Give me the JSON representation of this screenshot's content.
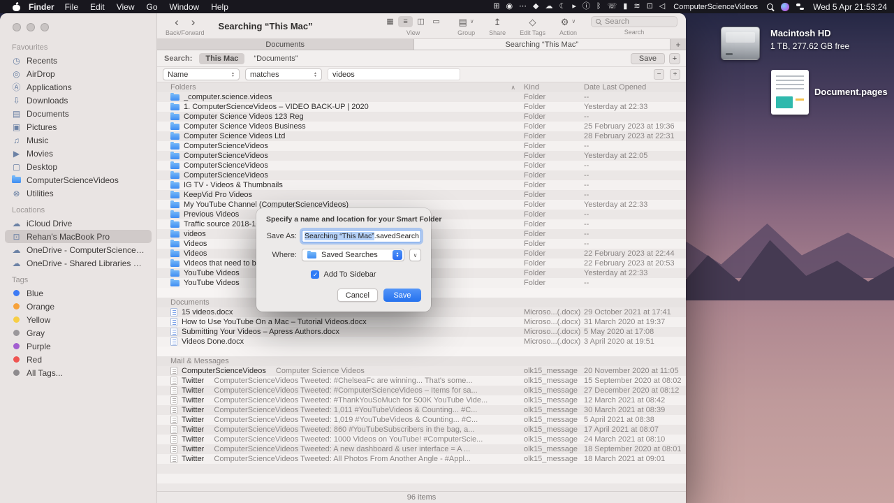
{
  "menubar": {
    "apple_icon": "apple-logo",
    "app_name": "Finder",
    "menus": [
      "File",
      "Edit",
      "View",
      "Go",
      "Window",
      "Help"
    ],
    "status_icons": [
      {
        "name": "window-manager-icon",
        "glyph": "⊞"
      },
      {
        "name": "camera-icon",
        "glyph": "◉"
      },
      {
        "name": "more-options-icon",
        "glyph": "⋯"
      },
      {
        "name": "app-status-icon",
        "glyph": "◆"
      },
      {
        "name": "cloud-sync-icon",
        "glyph": "☁"
      },
      {
        "name": "do-not-disturb-icon",
        "glyph": "☾"
      },
      {
        "name": "screen-record-icon",
        "glyph": "▸"
      },
      {
        "name": "info-icon",
        "glyph": "ⓘ"
      },
      {
        "name": "bluetooth-icon",
        "glyph": "ᛒ"
      },
      {
        "name": "phone-icon",
        "glyph": "☏"
      },
      {
        "name": "battery-icon",
        "glyph": "▮"
      },
      {
        "name": "wifi-icon",
        "glyph": "≋"
      },
      {
        "name": "display-icon",
        "glyph": "⊡"
      },
      {
        "name": "volume-icon",
        "glyph": "◁"
      }
    ],
    "status_text": "ComputerScienceVideos",
    "system_icons": [
      {
        "name": "spotlight-icon",
        "css": "spotlight"
      },
      {
        "name": "siri-icon",
        "css": "siri"
      },
      {
        "name": "control-center-icon",
        "css": "control-center"
      }
    ],
    "clock": "Wed 5 Apr 21:53:24"
  },
  "desktop": {
    "volume": {
      "name": "Macintosh HD",
      "detail": "1 TB, 277.62 GB free"
    },
    "file": {
      "name": "Document.pages"
    }
  },
  "window": {
    "title": "Searching “This Mac”",
    "toolbar": {
      "back_icon": "‹",
      "forward_icon": "›",
      "back_forward_label": "Back/Forward",
      "view_label": "View",
      "view_segments": [
        {
          "name": "icon-view-icon",
          "glyph": "▦"
        },
        {
          "name": "list-view-icon",
          "glyph": "≡",
          "selected": true
        },
        {
          "name": "column-view-icon",
          "glyph": "◫"
        },
        {
          "name": "gallery-view-icon",
          "glyph": "▭"
        }
      ],
      "group_icon": "▤",
      "group_label": "Group",
      "share_icon": "↥",
      "share_label": "Share",
      "tags_icon": "◇",
      "edit_tags_label": "Edit Tags",
      "action_icon": "⚙",
      "action_label": "Action",
      "caret": "∨",
      "search_placeholder": "Search",
      "search_label": "Search"
    },
    "tabs": [
      {
        "label": "Documents",
        "active": false
      },
      {
        "label": "Searching “This Mac”",
        "active": true
      }
    ],
    "new_tab_label": "+",
    "search_bar": {
      "label": "Search:",
      "scopes": [
        {
          "label": "This Mac",
          "selected": true
        },
        {
          "label": "“Documents”",
          "selected": false
        }
      ],
      "save_label": "Save",
      "add_label": "+"
    },
    "filter": {
      "field": "Name",
      "operator": "matches",
      "value": "videos",
      "remove_label": "−",
      "add_label": "+",
      "stepper_up": "▲",
      "stepper_down": "▼"
    },
    "list": {
      "columns": {
        "kind": "Kind",
        "date": "Date Last Opened"
      },
      "collapse_glyph": "∧",
      "sections": [
        {
          "title": "Folders",
          "icon": "folder",
          "show_columns": true,
          "collapse": true,
          "rows": [
            {
              "name": "_computer.science.videos",
              "kind": "Folder",
              "date": "--"
            },
            {
              "name": "1. ComputerScienceVideos – VIDEO BACK-UP | 2020",
              "kind": "Folder",
              "date": "Yesterday at 22:33"
            },
            {
              "name": "Computer Science Videos 123 Reg",
              "kind": "Folder",
              "date": "--"
            },
            {
              "name": "Computer Science Videos Business",
              "kind": "Folder",
              "date": "25 February 2023 at 19:36"
            },
            {
              "name": "Computer Science Videos Ltd",
              "kind": "Folder",
              "date": "28 February 2023 at 22:31"
            },
            {
              "name": "ComputerScienceVideos",
              "kind": "Folder",
              "date": "--"
            },
            {
              "name": "ComputerScienceVideos",
              "kind": "Folder",
              "date": "Yesterday at 22:05"
            },
            {
              "name": "ComputerScienceVideos",
              "kind": "Folder",
              "date": "--"
            },
            {
              "name": "ComputerScienceVideos",
              "kind": "Folder",
              "date": "--"
            },
            {
              "name": "IG TV - Videos & Thumbnails",
              "kind": "Folder",
              "date": "--"
            },
            {
              "name": "KeepVid Pro Videos",
              "kind": "Folder",
              "date": "--"
            },
            {
              "name": "My YouTube Channel (ComputerScienceVideos)",
              "kind": "Folder",
              "date": "Yesterday at 22:33"
            },
            {
              "name": "Previous Videos",
              "kind": "Folder",
              "date": "--"
            },
            {
              "name": "Traffic source 2018-10-0",
              "kind": "Folder",
              "date": "--"
            },
            {
              "name": "videos",
              "kind": "Folder",
              "date": "--"
            },
            {
              "name": "Videos",
              "kind": "Folder",
              "date": "--"
            },
            {
              "name": "Videos",
              "kind": "Folder",
              "date": "22 February 2023 at 22:44"
            },
            {
              "name": "Videos that need to be E",
              "kind": "Folder",
              "date": "22 February 2023 at 20:53"
            },
            {
              "name": "YouTube Videos",
              "kind": "Folder",
              "date": "Yesterday at 22:33"
            },
            {
              "name": "YouTube Videos",
              "kind": "Folder",
              "date": "--"
            }
          ]
        },
        {
          "title": "Documents",
          "icon": "docx",
          "show_columns": false,
          "collapse": false,
          "rows": [
            {
              "name": "15 videos.docx",
              "kind": "Microso...(.docx)",
              "date": "29 October 2021 at 17:41"
            },
            {
              "name": "How to Use YouTube On a Mac – Tutorial Videos.docx",
              "kind": "Microso...(.docx)",
              "date": "31 March 2020 at 19:37"
            },
            {
              "name": "Submitting Your Videos – Apress Authors.docx",
              "kind": "Microso...(.docx)",
              "date": "5 May 2020 at 17:08"
            },
            {
              "name": "Videos Done.docx",
              "kind": "Microso...(.docx)",
              "date": "3 April 2020 at 19:51"
            }
          ]
        },
        {
          "title": "Mail & Messages",
          "icon": "message",
          "show_columns": false,
          "collapse": false,
          "rows": [
            {
              "name": "ComputerScienceVideos",
              "subtitle": "Computer Science Videos",
              "kind": "olk15_message",
              "date": "20 November 2020 at 11:05"
            },
            {
              "name": "Twitter",
              "subtitle": "ComputerScienceVideos Tweeted: #ChelseaFc are winning... That's some...",
              "kind": "olk15_message",
              "date": "15 September 2020 at 08:02"
            },
            {
              "name": "Twitter",
              "subtitle": "ComputerScienceVideos Tweeted: #ComputerScienceVideos – Items for sa...",
              "kind": "olk15_message",
              "date": "27 December 2020 at 08:12"
            },
            {
              "name": "Twitter",
              "subtitle": "ComputerScienceVideos Tweeted: #ThankYouSoMuch for 500K YouTube Vide...",
              "kind": "olk15_message",
              "date": "12 March 2021 at 08:42"
            },
            {
              "name": "Twitter",
              "subtitle": "ComputerScienceVideos Tweeted: 1,011 #YouTubeVideos & Counting... #C...",
              "kind": "olk15_message",
              "date": "30 March 2021 at 08:39"
            },
            {
              "name": "Twitter",
              "subtitle": "ComputerScienceVideos Tweeted: 1,019 #YouTubeVideos & Counting... #C...",
              "kind": "olk15_message",
              "date": "5 April 2021 at 08:38"
            },
            {
              "name": "Twitter",
              "subtitle": "ComputerScienceVideos Tweeted: 860 #YouTubeSubscribers in the bag, a...",
              "kind": "olk15_message",
              "date": "17 April 2021 at 08:07"
            },
            {
              "name": "Twitter",
              "subtitle": "ComputerScienceVideos Tweeted: 1000 Videos on YouTube! #ComputerScie...",
              "kind": "olk15_message",
              "date": "24 March 2021 at 08:10"
            },
            {
              "name": "Twitter",
              "subtitle": "ComputerScienceVideos Tweeted: A new dashboard & user interface = A ...",
              "kind": "olk15_message",
              "date": "18 September 2020 at 08:01"
            },
            {
              "name": "Twitter",
              "subtitle": "ComputerScienceVideos Tweeted: All Photos From Another Angle - #Appl...",
              "kind": "olk15_message",
              "date": "18 March 2021 at 09:01"
            }
          ]
        }
      ]
    },
    "status_bar": "96 items"
  },
  "sidebar": {
    "sections": [
      {
        "title": "Favourites",
        "items": [
          {
            "label": "Recents",
            "icon": "clock-icon",
            "glyph": "◷"
          },
          {
            "label": "AirDrop",
            "icon": "airdrop-icon",
            "glyph": "◎"
          },
          {
            "label": "Applications",
            "icon": "applications-icon",
            "glyph": "Ⓐ"
          },
          {
            "label": "Downloads",
            "icon": "downloads-icon",
            "glyph": "⇩"
          },
          {
            "label": "Documents",
            "icon": "documents-icon",
            "glyph": "▤"
          },
          {
            "label": "Pictures",
            "icon": "pictures-icon",
            "glyph": "▣"
          },
          {
            "label": "Music",
            "icon": "music-icon",
            "glyph": "♫"
          },
          {
            "label": "Movies",
            "icon": "movies-icon",
            "glyph": "▶"
          },
          {
            "label": "Desktop",
            "icon": "desktop-icon",
            "glyph": "▢"
          },
          {
            "label": "ComputerScienceVideos",
            "icon": "folder-icon",
            "shape": "folder"
          },
          {
            "label": "Utilities",
            "icon": "utilities-icon",
            "glyph": "⊗"
          }
        ]
      },
      {
        "title": "Locations",
        "items": [
          {
            "label": "iCloud Drive",
            "icon": "icloud-icon",
            "glyph": "☁"
          },
          {
            "label": "Rehan's MacBook Pro",
            "icon": "macbook-icon",
            "glyph": "⊡",
            "selected": true
          },
          {
            "label": "OneDrive - ComputerScienceVideos",
            "icon": "onedrive-icon",
            "glyph": "☁"
          },
          {
            "label": "OneDrive - Shared Libraries – Comp...",
            "icon": "onedrive-icon",
            "glyph": "☁"
          }
        ]
      },
      {
        "title": "Tags",
        "items": [
          {
            "label": "Blue",
            "icon": "blue-tag-icon",
            "color": "#3e7bf5"
          },
          {
            "label": "Orange",
            "icon": "orange-tag-icon",
            "color": "#f7a23b"
          },
          {
            "label": "Yellow",
            "icon": "yellow-tag-icon",
            "color": "#f7ce45"
          },
          {
            "label": "Gray",
            "icon": "gray-tag-icon",
            "color": "#9b989b"
          },
          {
            "label": "Purple",
            "icon": "purple-tag-icon",
            "color": "#a35fd0"
          },
          {
            "label": "Red",
            "icon": "red-tag-icon",
            "color": "#ef5552"
          },
          {
            "label": "All Tags...",
            "icon": "all-tags-icon",
            "color": "#8e8b8e"
          }
        ]
      }
    ]
  },
  "dialog": {
    "title": "Specify a name and location for your Smart Folder",
    "save_as_label": "Save As:",
    "filename_selected": "Searching “This Mac”",
    "filename_rest": ".savedSearch",
    "where_label": "Where:",
    "where_value": "Saved Searches",
    "stepper_up": "▲",
    "stepper_down": "▼",
    "disclosure_glyph": "∨",
    "checkbox_check": "✓",
    "checkbox_label": "Add To Sidebar",
    "cancel_label": "Cancel",
    "save_label": "Save"
  }
}
